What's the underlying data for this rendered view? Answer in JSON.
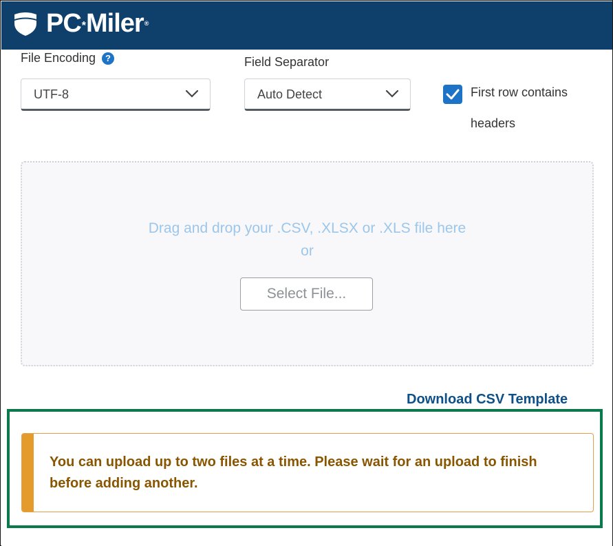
{
  "app": {
    "brand": "PC",
    "brand_star": "*",
    "brand_tail": "Miler",
    "brand_reg": "®"
  },
  "form": {
    "file_encoding_label": "File Encoding",
    "help_icon_glyph": "?",
    "file_encoding_value": "UTF-8",
    "field_separator_label": "Field Separator",
    "field_separator_value": "Auto Detect",
    "first_row_headers_label": "First row contains headers",
    "first_row_headers_checked": true
  },
  "dropzone": {
    "instruction": "Drag and drop your .CSV, .XLSX or .XLS file here",
    "or_text": "or",
    "select_file_label": "Select File..."
  },
  "download_template_label": "Download CSV Template",
  "alert": {
    "message": "You can upload up to two files at a time. Please wait for an upload to finish before adding another."
  },
  "colors": {
    "header_bg": "#0f3f6b",
    "accent_blue": "#1d73c6",
    "link": "#0d4f86",
    "highlight_border": "#0a7a4d",
    "alert_bar": "#e59a2c",
    "alert_text": "#8a5500"
  },
  "icons": {
    "logo": "shield-icon",
    "help": "question-circle-icon",
    "dropdown": "chevron-down-icon",
    "checkbox": "checkmark-icon"
  }
}
